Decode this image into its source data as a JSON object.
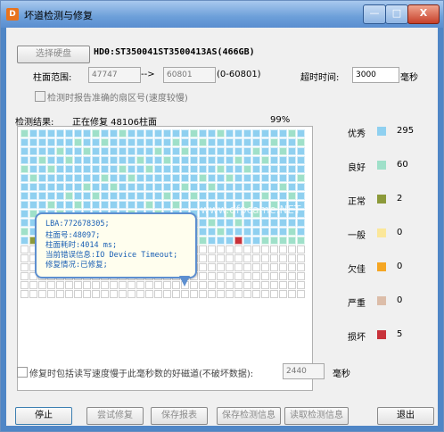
{
  "window": {
    "title": "坏道检测与修复",
    "app_icon": "app-icon-orange",
    "min_label": "—",
    "max_label": "□",
    "close_label": "X"
  },
  "toolbar": {
    "select_disk_button": "选择硬盘",
    "disk_label": "HD0:ST350041ST3500413AS(466GB)"
  },
  "cylinder": {
    "label": "柱面范围:",
    "start": "47747",
    "arrow": "-->",
    "end": "60801",
    "range_hint": "(0-60801)"
  },
  "timeout": {
    "label": "超时时间:",
    "value": "3000",
    "unit": "毫秒"
  },
  "sector_check": {
    "label": "检测时报告准确的扇区号(速度较慢)",
    "checked": false
  },
  "result": {
    "label": "检测结果:",
    "status": "正在修复 48106柱面",
    "percent": "99%"
  },
  "legend": [
    {
      "name": "优秀",
      "color": "#8fd0f0",
      "count": "295"
    },
    {
      "name": "良好",
      "color": "#9fe0c9",
      "count": "60"
    },
    {
      "name": "正常",
      "color": "#8c9a3a",
      "count": "2"
    },
    {
      "name": "一般",
      "color": "#fbe79a",
      "count": "0"
    },
    {
      "name": "欠佳",
      "color": "#f5a623",
      "count": "0"
    },
    {
      "name": "严重",
      "color": "#dcbda9",
      "count": "0"
    },
    {
      "name": "损坏",
      "color": "#c8323a",
      "count": "5"
    }
  ],
  "tooltip": {
    "lba": "LBA:772678305;",
    "cylinder": "柱面号:48097;",
    "time": "柱面耗时:4014 ms;",
    "error": "当前错误信息:IO Device Timeout;",
    "repair": "修复情况:已修复;"
  },
  "watermark": "www.dfpcame.NET",
  "repair_option": {
    "label": "修复时包括读写速度慢于此毫秒数的好磁道(不破坏数据):",
    "value": "2440",
    "unit": "毫秒",
    "checked": false
  },
  "buttons": {
    "stop": "停止",
    "try_repair": "尝试修复",
    "save_report": "保存报表",
    "save_info": "保存检测信息",
    "read_info": "读取检测信息",
    "exit": "退出"
  }
}
